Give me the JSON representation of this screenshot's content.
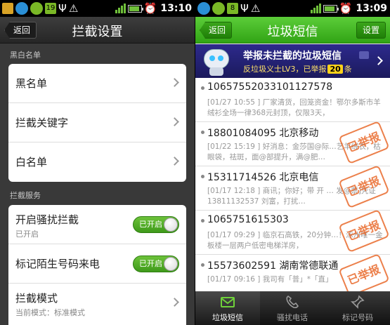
{
  "left": {
    "status": {
      "time": "13:10",
      "battery_level": 0.9
    },
    "title": "拦截设置",
    "back_label": "返回",
    "section1_label": "黑白名单",
    "section1_items": [
      {
        "label": "黑名单"
      },
      {
        "label": "拦截关键字"
      },
      {
        "label": "白名单"
      }
    ],
    "section2_label": "拦截服务",
    "section2_items": [
      {
        "label": "开启骚扰拦截",
        "sub": "已开启",
        "toggle": "已开启"
      },
      {
        "label": "标记陌生号码来电",
        "toggle": "已开启"
      },
      {
        "label": "拦截模式",
        "sub": "当前模式：标准模式"
      }
    ]
  },
  "right": {
    "status": {
      "time": "13:09",
      "battery_level": 0.9
    },
    "title": "垃圾短信",
    "back_label": "返回",
    "settings_label": "设置",
    "banner": {
      "line1": "举报未拦截的垃圾短信",
      "line2_prefix": "反垃圾义士LV3，已举报",
      "count": "20",
      "line2_suffix": "条"
    },
    "messages": [
      {
        "number": "10657552033101127578",
        "preview": "[01/27 10:55 ] 厂家清货，回笼资金！鄂尔多斯市羊绒衫全场一律368元封顶，仅限3天，",
        "reported": false
      },
      {
        "number": "18801084095 北京移动",
        "preview": "[01/22 15:19 ] 好消息：金莎国@际…艺羊绒衣，枯眼袋，祛斑，面@部提升，满@肥…",
        "reported": true
      },
      {
        "number": "15311714526 北京电信",
        "preview": "[01/17 12:18 ] 商讯；你好；带 开 … 发@票]凭证 13811132537 刘富，打扰…",
        "reported": true
      },
      {
        "number": "1065751615303",
        "preview": "[01/17 09:29 ] 临京石高铁，20分钟…！涿州唯一金板楼一层两户低密电梯洋房，",
        "reported": true
      },
      {
        "number": "15573602591 湖南常德联通",
        "preview": "[01/17 09:16 ] 我司有「普」*「直」",
        "reported": true
      }
    ],
    "stamp_text": "已举报",
    "tabs": [
      {
        "label": "垃圾短信",
        "active": true
      },
      {
        "label": "骚扰电话",
        "active": false
      },
      {
        "label": "标记号码",
        "active": false
      }
    ]
  },
  "colors": {
    "green": "#3fae1f",
    "stamp": "#e96a2c",
    "banner": "#24226f"
  }
}
